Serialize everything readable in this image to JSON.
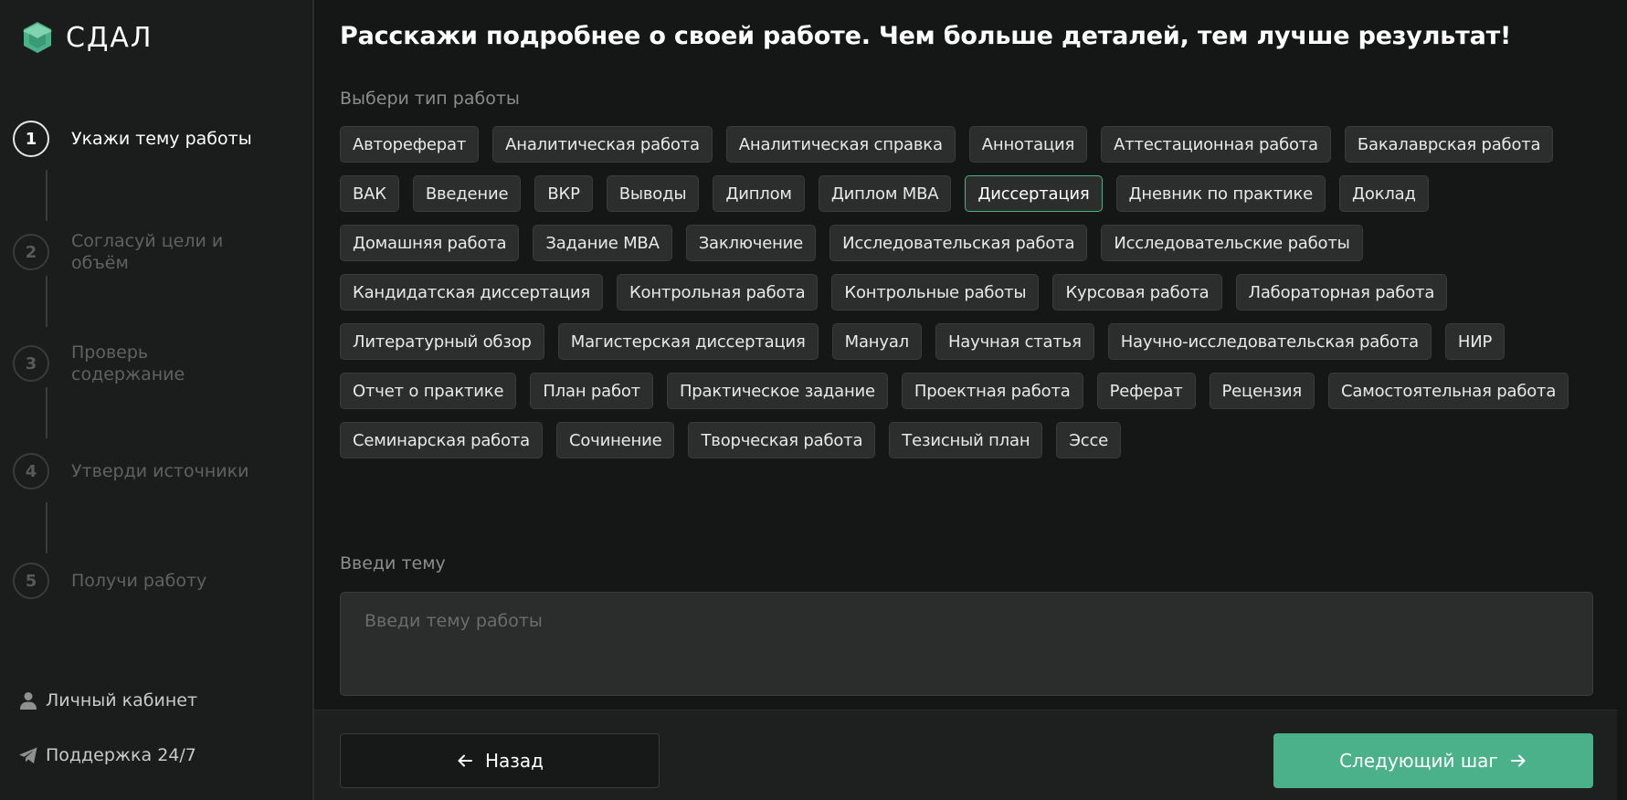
{
  "brand": {
    "name": "СДАЛ",
    "accent": "#4ab18a"
  },
  "steps": [
    {
      "number": "1",
      "label": "Укажи тему работы",
      "active": true
    },
    {
      "number": "2",
      "label": "Согласуй цели и объём",
      "active": false
    },
    {
      "number": "3",
      "label": "Проверь содержание",
      "active": false
    },
    {
      "number": "4",
      "label": "Утверди источники",
      "active": false
    },
    {
      "number": "5",
      "label": "Получи работу",
      "active": false
    }
  ],
  "sidebar_bottom": {
    "account_label": "Личный кабинет",
    "support_label": "Поддержка 24/7"
  },
  "main": {
    "title": "Расскажи подробнее о своей работе. Чем больше деталей, тем лучше результат!",
    "work_type_label": "Выбери тип работы",
    "selected_type": "Диссертация",
    "work_types": [
      "Автореферат",
      "Аналитическая работа",
      "Аналитическая справка",
      "Аннотация",
      "Аттестационная работа",
      "Бакалаврская работа",
      "ВАК",
      "Введение",
      "ВКР",
      "Выводы",
      "Диплом",
      "Диплом MBA",
      "Диссертация",
      "Дневник по практике",
      "Доклад",
      "Домашняя работа",
      "Задание MBA",
      "Заключение",
      "Исследовательская работа",
      "Исследовательские работы",
      "Кандидатская диссертация",
      "Контрольная работа",
      "Контрольные работы",
      "Курсовая работа",
      "Лабораторная работа",
      "Литературный обзор",
      "Магистерская диссертация",
      "Мануал",
      "Научная статья",
      "Научно-исследовательская работа",
      "НИР",
      "Отчет о практике",
      "План работ",
      "Практическое задание",
      "Проектная работа",
      "Реферат",
      "Рецензия",
      "Самостоятельная работа",
      "Семинарская работа",
      "Сочинение",
      "Творческая работа",
      "Тезисный план",
      "Эссе"
    ],
    "topic_label": "Введи тему",
    "topic_placeholder": "Введи тему работы",
    "topic_value": ""
  },
  "footer": {
    "back_label": "Назад",
    "next_label": "Следующий шаг"
  }
}
